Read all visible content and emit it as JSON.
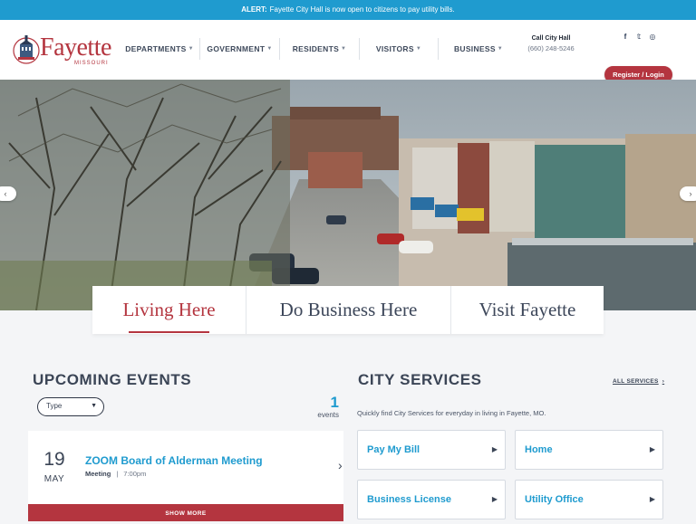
{
  "alert": {
    "label": "ALERT:",
    "text": "Fayette City Hall is now open to citizens to pay utility bills."
  },
  "logo": {
    "word": "Fayette",
    "state": "MISSOURI"
  },
  "nav": [
    {
      "label": "DEPARTMENTS"
    },
    {
      "label": "GOVERNMENT"
    },
    {
      "label": "RESIDENTS"
    },
    {
      "label": "VISITORS"
    },
    {
      "label": "BUSINESS"
    }
  ],
  "call": {
    "title": "Call City Hall",
    "phone": "(660) 248-5246"
  },
  "social": {
    "facebook": "f",
    "twitter": "𝕥",
    "instagram": "◎"
  },
  "login": {
    "label": "Register / Login"
  },
  "hero": {
    "prev": "‹",
    "next": "›"
  },
  "tabs": [
    {
      "label": "Living Here",
      "active": true
    },
    {
      "label": "Do Business Here",
      "active": false
    },
    {
      "label": "Visit Fayette",
      "active": false
    }
  ],
  "events": {
    "title": "UPCOMING EVENTS",
    "filter": "Type",
    "count": "1",
    "count_label": "events",
    "items": [
      {
        "day": "19",
        "month": "MAY",
        "title": "ZOOM Board of Alderman Meeting",
        "category": "Meeting",
        "time": "7:00pm"
      }
    ],
    "show_more": "SHOW MORE"
  },
  "services": {
    "title": "CITY SERVICES",
    "all_label": "ALL SERVICES",
    "description": "Quickly find City Services for everyday in living in Fayette, MO.",
    "items": [
      {
        "label": "Pay My Bill"
      },
      {
        "label": "Home"
      },
      {
        "label": "Business License"
      },
      {
        "label": "Utility Office"
      }
    ]
  },
  "colors": {
    "accent": "#1f9bcf",
    "brand": "#b4353f",
    "alert_bg": "#1f9bcf"
  }
}
